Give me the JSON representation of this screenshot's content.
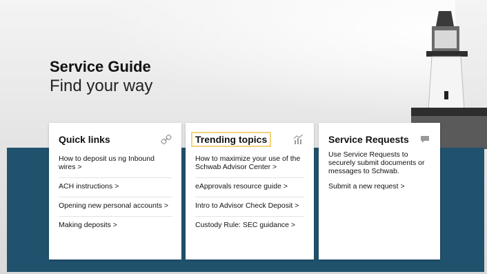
{
  "hero": {
    "title": "Service Guide",
    "subtitle": "Find your way"
  },
  "quick_links": {
    "title": "Quick links",
    "icon": "link-icon",
    "items": [
      "How to deposit us ng Inbound wires >",
      "ACH instructions >",
      "Opening new personal accounts >",
      "Making deposits >"
    ]
  },
  "trending_topics": {
    "title": "Trending topics",
    "icon": "chart-icon",
    "items": [
      "How to maximize your use of the Schwab Advisor Center >",
      "eApprovals resource guide >",
      "Intro to Advisor Check Deposit >",
      "Custody Rule: SEC guidance >"
    ]
  },
  "service_requests": {
    "title": "Service Requests",
    "icon": "chat-bubble-icon",
    "description": "Use Service Requests to securely submit documents or messages to Schwab.",
    "link": "Submit a new request >"
  },
  "colors": {
    "band": "#20526d",
    "highlight": "#f2d27a"
  }
}
